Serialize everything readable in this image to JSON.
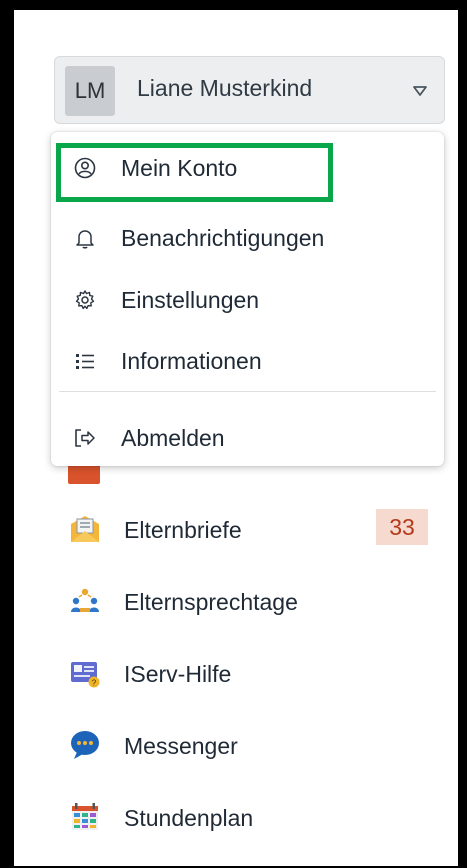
{
  "user": {
    "initials": "LM",
    "name": "Liane Musterkind"
  },
  "dropdown": {
    "items": [
      {
        "label": "Mein Konto",
        "icon": "user-circle-icon"
      },
      {
        "label": "Benachrichtigungen",
        "icon": "bell-icon"
      },
      {
        "label": "Einstellungen",
        "icon": "gear-icon"
      },
      {
        "label": "Informationen",
        "icon": "list-icon"
      },
      {
        "label": "Abmelden",
        "icon": "logout-icon"
      }
    ],
    "highlighted": "Mein Konto"
  },
  "nav": {
    "items": [
      {
        "label": "Elternbriefe",
        "icon": "letter-icon",
        "badge": "33"
      },
      {
        "label": "Elternsprechtage",
        "icon": "meeting-people-icon"
      },
      {
        "label": "IServ-Hilfe",
        "icon": "help-screen-icon"
      },
      {
        "label": "Messenger",
        "icon": "chat-bubble-icon"
      },
      {
        "label": "Stundenplan",
        "icon": "timetable-icon"
      }
    ]
  },
  "colors": {
    "highlight": "#0aa64a",
    "badge_bg": "#f6d9cf",
    "badge_text": "#b33a1a"
  }
}
